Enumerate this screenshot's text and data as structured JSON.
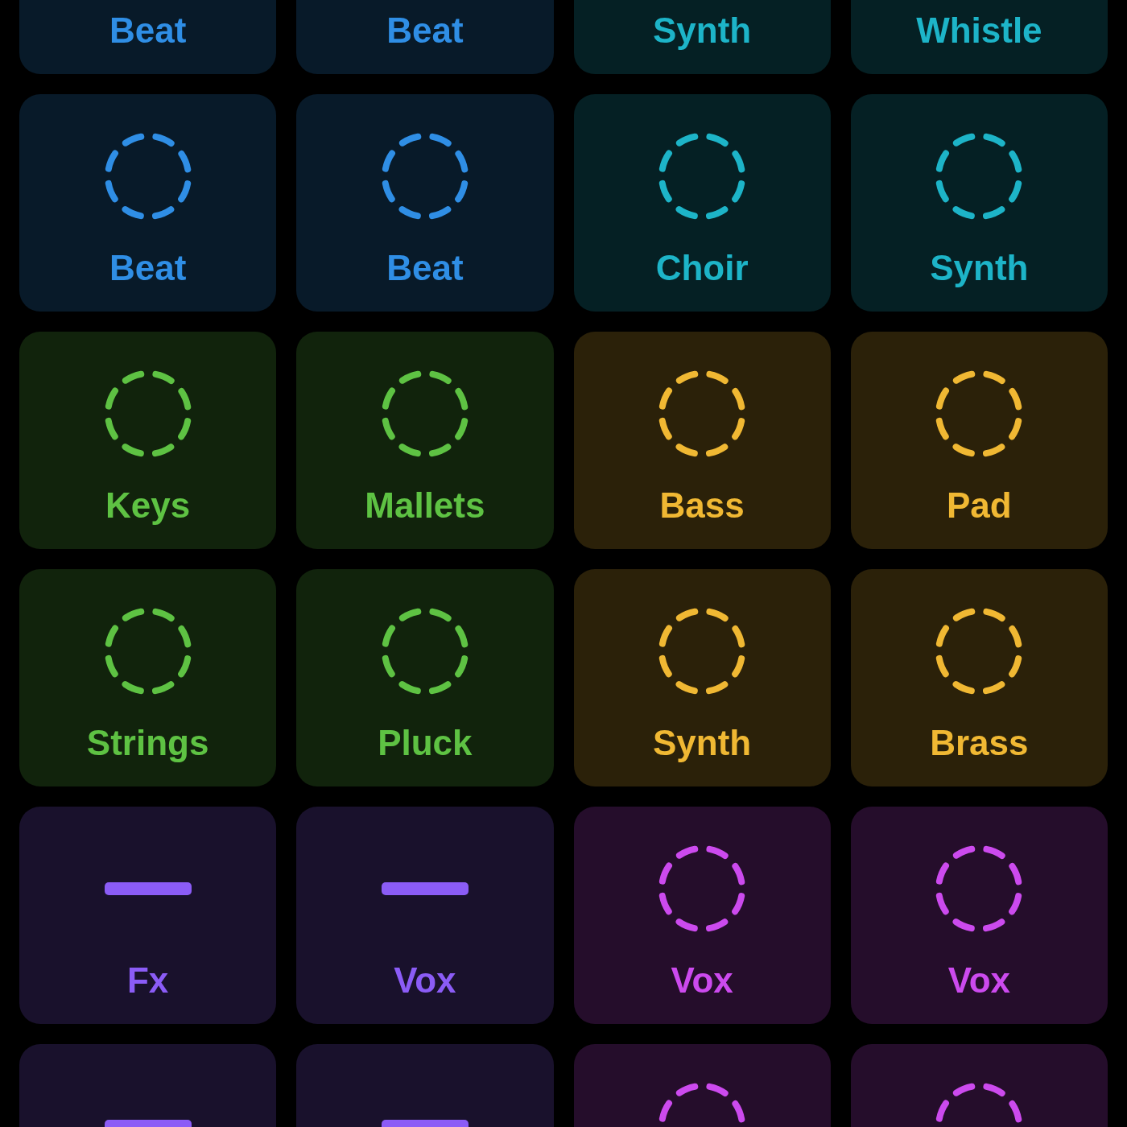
{
  "grid": {
    "rows": [
      {
        "cells": [
          {
            "label": "Beat",
            "color": "#2f8ee5"
          },
          {
            "label": "Beat",
            "color": "#2f8ee5"
          },
          {
            "label": "Synth",
            "color": "#1db4c8"
          },
          {
            "label": "Whistle",
            "color": "#1db4c8"
          }
        ]
      },
      {
        "cells": [
          {
            "label": "Beat",
            "color": "#2f8ee5",
            "kind": "ring"
          },
          {
            "label": "Beat",
            "color": "#2f8ee5",
            "kind": "ring"
          },
          {
            "label": "Choir",
            "color": "#1db4c8",
            "kind": "ring"
          },
          {
            "label": "Synth",
            "color": "#1db4c8",
            "kind": "ring"
          }
        ]
      },
      {
        "cells": [
          {
            "label": "Keys",
            "color": "#5ec243",
            "kind": "ring"
          },
          {
            "label": "Mallets",
            "color": "#5ec243",
            "kind": "ring"
          },
          {
            "label": "Bass",
            "color": "#f0b833",
            "kind": "ring"
          },
          {
            "label": "Pad",
            "color": "#f0b833",
            "kind": "ring"
          }
        ]
      },
      {
        "cells": [
          {
            "label": "Strings",
            "color": "#5ec243",
            "kind": "ring"
          },
          {
            "label": "Pluck",
            "color": "#5ec243",
            "kind": "ring"
          },
          {
            "label": "Synth",
            "color": "#f0b833",
            "kind": "ring"
          },
          {
            "label": "Brass",
            "color": "#f0b833",
            "kind": "ring"
          }
        ]
      },
      {
        "cells": [
          {
            "label": "Fx",
            "color": "#8b5cf6",
            "kind": "bar"
          },
          {
            "label": "Vox",
            "color": "#8b5cf6",
            "kind": "bar"
          },
          {
            "label": "Vox",
            "color": "#cc4aee",
            "kind": "ring"
          },
          {
            "label": "Vox",
            "color": "#cc4aee",
            "kind": "ring"
          }
        ]
      },
      {
        "cells": [
          {
            "color": "#8b5cf6",
            "kind": "bar"
          },
          {
            "color": "#8b5cf6",
            "kind": "bar"
          },
          {
            "color": "#cc4aee",
            "kind": "ring"
          },
          {
            "color": "#cc4aee",
            "kind": "ring"
          }
        ]
      }
    ]
  }
}
